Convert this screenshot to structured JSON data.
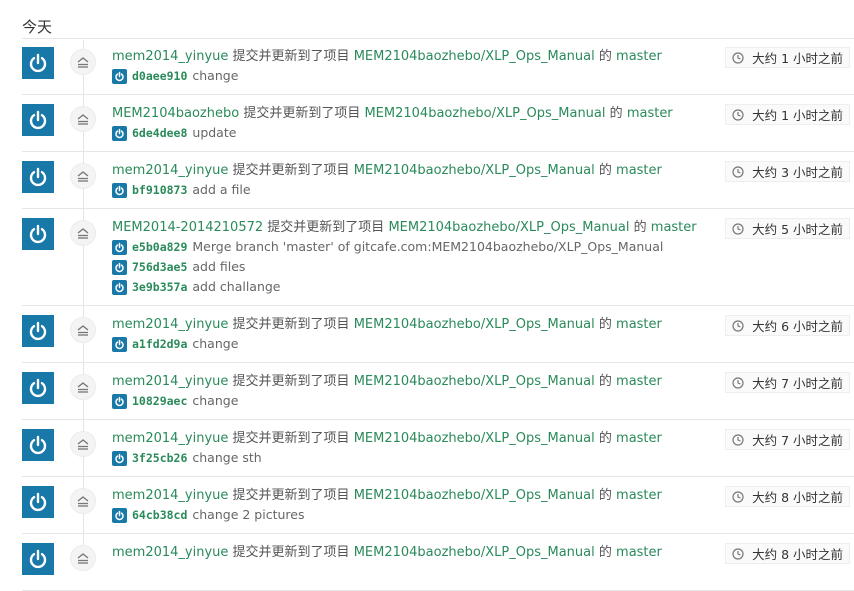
{
  "section_heading": "今天",
  "colors": {
    "link": "#2a8a5a",
    "avatar_bg": "#1878a8",
    "rule": "#e6e6e6"
  },
  "icons": {
    "avatar": "power-icon",
    "event": "push-icon",
    "time": "clock-icon"
  },
  "events": [
    {
      "user": "mem2014_yinyue",
      "action": "提交并更新到了项目",
      "repo": "MEM2104baozhebo/XLP_Ops_Manual",
      "of": "的",
      "branch": "master",
      "time": "大约 1 小时之前",
      "commits": [
        {
          "sha": "d0aee910",
          "message": "change"
        }
      ]
    },
    {
      "user": "MEM2104baozhebo",
      "action": "提交并更新到了项目",
      "repo": "MEM2104baozhebo/XLP_Ops_Manual",
      "of": "的",
      "branch": "master",
      "time": "大约 1 小时之前",
      "commits": [
        {
          "sha": "6de4dee8",
          "message": "update"
        }
      ]
    },
    {
      "user": "mem2014_yinyue",
      "action": "提交并更新到了项目",
      "repo": "MEM2104baozhebo/XLP_Ops_Manual",
      "of": "的",
      "branch": "master",
      "time": "大约 3 小时之前",
      "commits": [
        {
          "sha": "bf910873",
          "message": "add a file"
        }
      ]
    },
    {
      "user": "MEM2014-2014210572",
      "action": "提交并更新到了项目",
      "repo": "MEM2104baozhebo/XLP_Ops_Manual",
      "of": "的",
      "branch": "master",
      "time": "大约 5 小时之前",
      "commits": [
        {
          "sha": "e5b0a829",
          "message": "Merge branch 'master' of gitcafe.com:MEM2104baozhebo/XLP_Ops_Manual"
        },
        {
          "sha": "756d3ae5",
          "message": "add files"
        },
        {
          "sha": "3e9b357a",
          "message": "add challange"
        }
      ]
    },
    {
      "user": "mem2014_yinyue",
      "action": "提交并更新到了项目",
      "repo": "MEM2104baozhebo/XLP_Ops_Manual",
      "of": "的",
      "branch": "master",
      "time": "大约 6 小时之前",
      "commits": [
        {
          "sha": "a1fd2d9a",
          "message": "change"
        }
      ]
    },
    {
      "user": "mem2014_yinyue",
      "action": "提交并更新到了项目",
      "repo": "MEM2104baozhebo/XLP_Ops_Manual",
      "of": "的",
      "branch": "master",
      "time": "大约 7 小时之前",
      "commits": [
        {
          "sha": "10829aec",
          "message": "change"
        }
      ]
    },
    {
      "user": "mem2014_yinyue",
      "action": "提交并更新到了项目",
      "repo": "MEM2104baozhebo/XLP_Ops_Manual",
      "of": "的",
      "branch": "master",
      "time": "大约 7 小时之前",
      "commits": [
        {
          "sha": "3f25cb26",
          "message": "change sth"
        }
      ]
    },
    {
      "user": "mem2014_yinyue",
      "action": "提交并更新到了项目",
      "repo": "MEM2104baozhebo/XLP_Ops_Manual",
      "of": "的",
      "branch": "master",
      "time": "大约 8 小时之前",
      "commits": [
        {
          "sha": "64cb38cd",
          "message": "change 2 pictures"
        }
      ]
    },
    {
      "user": "mem2014_yinyue",
      "action": "提交并更新到了项目",
      "repo": "MEM2104baozhebo/XLP_Ops_Manual",
      "of": "的",
      "branch": "master",
      "time": "大约 8 小时之前",
      "commits": []
    }
  ]
}
